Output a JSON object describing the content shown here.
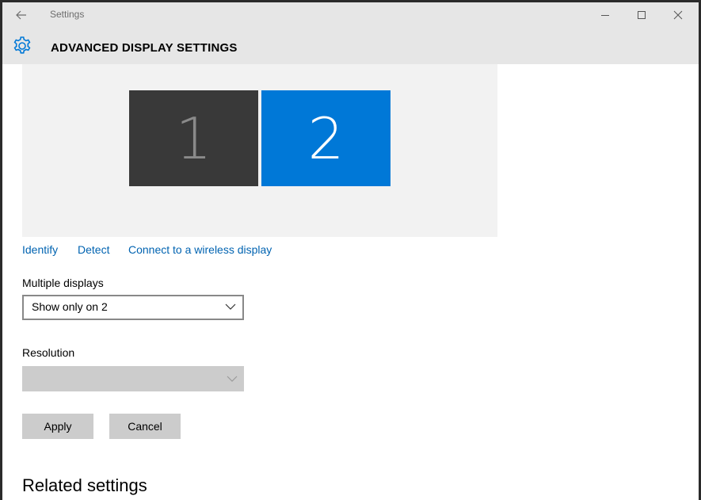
{
  "window": {
    "app_title": "Settings",
    "back_icon": "back-arrow-icon",
    "controls": [
      "minimize-icon",
      "maximize-icon",
      "close-icon"
    ]
  },
  "header": {
    "icon": "gear-icon",
    "title": "ADVANCED DISPLAY SETTINGS"
  },
  "display_arrangement": {
    "monitors": [
      {
        "number": "1",
        "selected": false,
        "color": "#393939"
      },
      {
        "number": "2",
        "selected": true,
        "color": "#0078d7"
      }
    ]
  },
  "links": {
    "identify": "Identify",
    "detect": "Detect",
    "wireless": "Connect to a wireless display"
  },
  "multiple_displays": {
    "label": "Multiple displays",
    "selected": "Show only on 2"
  },
  "resolution": {
    "label": "Resolution",
    "selected": "",
    "disabled": true
  },
  "buttons": {
    "apply": "Apply",
    "cancel": "Cancel"
  },
  "related": {
    "heading": "Related settings"
  },
  "colors": {
    "accent": "#0078d7",
    "link": "#0063b1",
    "chrome": "#e6e6e6"
  }
}
